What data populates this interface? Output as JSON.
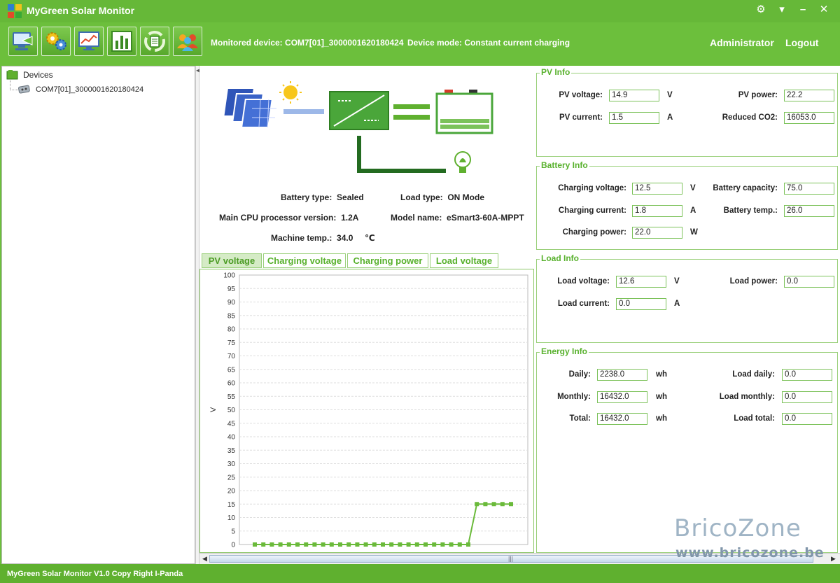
{
  "app": {
    "title": "MyGreen Solar Monitor"
  },
  "toolbar": {
    "monitored_label": "Monitored device:",
    "monitored_value": "COM7[01]_3000001620180424",
    "mode_label": "Device mode:",
    "mode_value": "Constant current charging",
    "user": "Administrator",
    "logout": "Logout",
    "tools": [
      "monitor-icon",
      "settings-icon",
      "history-icon",
      "chart-icon",
      "recycle-icon",
      "users-icon"
    ]
  },
  "tree": {
    "root": "Devices",
    "child": "COM7[01]_3000001620180424"
  },
  "device_info": {
    "battery_type_label": "Battery type:",
    "battery_type": "Sealed",
    "load_type_label": "Load type:",
    "load_type": "ON Mode",
    "cpu_label": "Main CPU processor version:",
    "cpu": "1.2A",
    "model_label": "Model name:",
    "model": "eSmart3-60A-MPPT",
    "temp_label": "Machine temp.:",
    "temp": "34.0",
    "temp_unit": "℃"
  },
  "tabs": [
    "PV voltage",
    "Charging voltage",
    "Charging power",
    "Load voltage"
  ],
  "chart_data": {
    "type": "line",
    "ylabel": "V",
    "ylim": [
      0,
      100
    ],
    "yticks": [
      0,
      5,
      10,
      15,
      20,
      25,
      30,
      35,
      40,
      45,
      50,
      55,
      60,
      65,
      70,
      75,
      80,
      85,
      90,
      95,
      100
    ],
    "series": [
      {
        "values": [
          0,
          0,
          0,
          0,
          0,
          0,
          0,
          0,
          0,
          0,
          0,
          0,
          0,
          0,
          0,
          0,
          0,
          0,
          0,
          0,
          0,
          0,
          0,
          0,
          0,
          0,
          15,
          15,
          15,
          15,
          15
        ]
      }
    ],
    "line_color": "#6aba3a",
    "grid": true
  },
  "pv_info": {
    "title": "PV Info",
    "voltage_label": "PV voltage:",
    "voltage": "14.9",
    "voltage_unit": "V",
    "current_label": "PV current:",
    "current": "1.5",
    "current_unit": "A",
    "power_label": "PV power:",
    "power": "22.2",
    "co2_label": "Reduced CO2:",
    "co2": "16053.0"
  },
  "battery_info": {
    "title": "Battery Info",
    "cv_label": "Charging voltage:",
    "cv": "12.5",
    "cv_unit": "V",
    "cc_label": "Charging current:",
    "cc": "1.8",
    "cc_unit": "A",
    "cp_label": "Charging power:",
    "cp": "22.0",
    "cp_unit": "W",
    "cap_label": "Battery capacity:",
    "cap": "75.0",
    "temp_label": "Battery temp.:",
    "temp": "26.0"
  },
  "load_info": {
    "title": "Load Info",
    "lv_label": "Load voltage:",
    "lv": "12.6",
    "lv_unit": "V",
    "lc_label": "Load current:",
    "lc": "0.0",
    "lc_unit": "A",
    "lp_label": "Load power:",
    "lp": "0.0"
  },
  "energy_info": {
    "title": "Energy Info",
    "daily_label": "Daily:",
    "daily": "2238.0",
    "daily_unit": "wh",
    "monthly_label": "Monthly:",
    "monthly": "16432.0",
    "monthly_unit": "wh",
    "total_label": "Total:",
    "total": "16432.0",
    "total_unit": "wh",
    "load_daily_label": "Load daily:",
    "load_daily": "0.0",
    "load_monthly_label": "Load monthly:",
    "load_monthly": "0.0",
    "load_total_label": "Load total:",
    "load_total": "0.0"
  },
  "status": {
    "text": "MyGreen Solar Monitor V1.0   Copy Right I-Panda"
  },
  "watermark": {
    "brand": "BricoZone",
    "url": "www.bricozone.be"
  },
  "colors": {
    "accent": "#6cbf3c",
    "tab_text": "#58b12d",
    "field_border": "#7cc25a"
  }
}
